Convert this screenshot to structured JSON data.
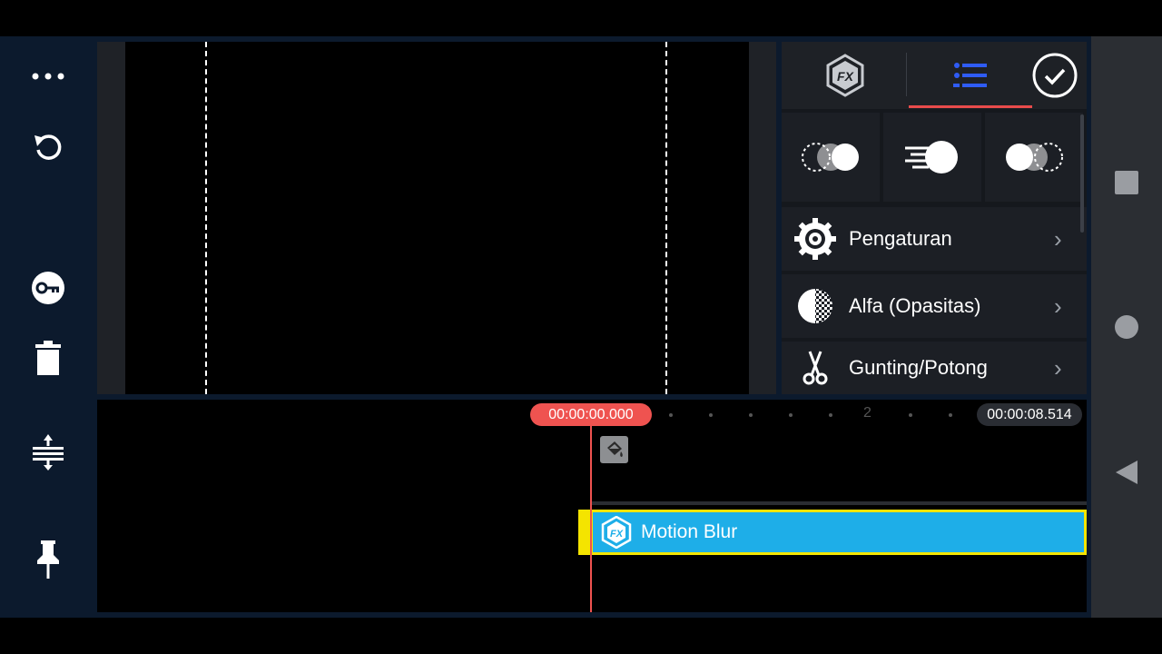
{
  "panel": {
    "tabs": [
      {
        "name": "fx-tab",
        "icon": "fx-hexagon-icon"
      },
      {
        "name": "list-tab",
        "icon": "list-icon",
        "active": true
      }
    ],
    "done_icon": "checkmark-circle-icon",
    "presets": [
      {
        "icon": "motion-left-icon"
      },
      {
        "icon": "motion-speed-icon"
      },
      {
        "icon": "motion-right-icon"
      }
    ],
    "menu": [
      {
        "label": "Pengaturan",
        "icon": "gear-icon"
      },
      {
        "label": "Alfa (Opasitas)",
        "icon": "opacity-checker-icon"
      },
      {
        "label": "Gunting/Potong",
        "icon": "scissors-icon"
      }
    ]
  },
  "left_toolbar": [
    "more-icon",
    "undo-icon",
    "key-icon",
    "trash-icon",
    "split-icon",
    "pin-icon"
  ],
  "timeline": {
    "current_time": "00:00:00.000",
    "end_time": "00:00:08.514",
    "ruler_mark": "2",
    "clip_label": "Motion Blur"
  },
  "colors": {
    "accent_red": "#ef5350",
    "clip_blue": "#1eaee8",
    "clip_border": "#f4e400",
    "tab_active_blue": "#2f5cf5"
  }
}
